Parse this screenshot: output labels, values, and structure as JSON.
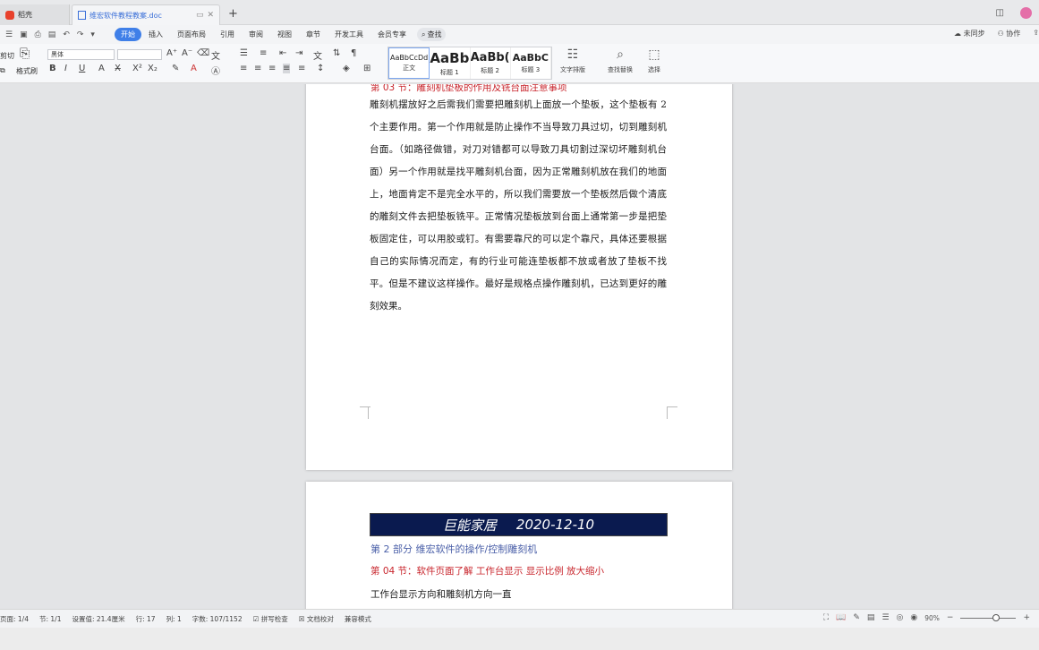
{
  "tabs": {
    "home": "稻壳",
    "doc_title": "维宏软件教程教案.doc",
    "new_tab": "+"
  },
  "menu": {
    "items": [
      "开始",
      "插入",
      "页面布局",
      "引用",
      "审阅",
      "视图",
      "章节",
      "开发工具",
      "会员专享"
    ],
    "search": "查找",
    "right": [
      "未同步",
      "协作"
    ]
  },
  "toolbar": {
    "cut": "剪切",
    "format_painter": "格式刷",
    "font_name": "黑体",
    "font_size": "",
    "styles": [
      {
        "sample": "AaBbCcDd",
        "name": "正文"
      },
      {
        "sample": "AaBb",
        "name": "标题 1"
      },
      {
        "sample": "AaBb(",
        "name": "标题 2"
      },
      {
        "sample": "AaBbC",
        "name": "标题 3"
      }
    ],
    "text_layout": "文字排版",
    "find_replace": "查找替换",
    "select": "选择"
  },
  "document": {
    "page1_heading": "第 03 节：雕刻机垫板的作用及铣台面注意事项",
    "page1_paragraph": "雕刻机摆放好之后需我们需要把雕刻机上面放一个垫板，这个垫板有 2 个主要作用。第一个作用就是防止操作不当导致刀具过切，切到雕刻机台面。（如路径做错，对刀对错都可以导致刀具切割过深切坏雕刻机台面）另一个作用就是找平雕刻机台面，因为正常雕刻机放在我们的地面上，地面肯定不是完全水平的，所以我们需要放一个垫板然后做个清底的雕刻文件去把垫板铣平。正常情况垫板放到台面上通常第一步是把垫板固定住，可以用胶或钉。有需要靠尺的可以定个靠尺，具体还要根据自己的实际情况而定，有的行业可能连垫板都不放或者放了垫板不找平。但是不建议这样操作。最好是规格点操作雕刻机，已达到更好的雕刻效果。",
    "banner_left": "巨能家居",
    "banner_right": "2020-12-10",
    "page2_subtitle": "第 2 部分  维宏软件的操作/控制雕刻机",
    "page2_heading": "第 04 节：软件页面了解  工作台显示  显示比例  放大缩小",
    "page2_line": "工作台显示方向和雕刻机方向一直"
  },
  "status": {
    "page": "页面: 1/4",
    "section": "节: 1/1",
    "setting": "设置值: 21.4厘米",
    "row": "行: 17",
    "col": "列: 1",
    "wordcount": "字数: 107/1152",
    "spellcheck": "拼写检查",
    "proofread": "文档校对",
    "compat": "兼容模式",
    "zoom": "90%"
  },
  "colors": {
    "accent": "#3f7fe8",
    "heading_red": "#c8252c",
    "banner_bg": "#0a1a4f"
  }
}
